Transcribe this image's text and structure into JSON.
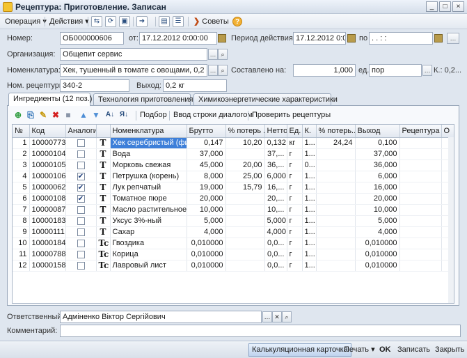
{
  "window": {
    "title": "Рецептура: Приготовление. Записан",
    "minimize": "_",
    "maximize": "□",
    "close": "×"
  },
  "toolbar": {
    "operation": "Операция ▾",
    "actions": "Действия ▾",
    "tips": "Советы"
  },
  "header": {
    "number_label": "Номер:",
    "number_value": "ОБ000000606",
    "from_label": "от:",
    "from_value": "17.12.2012  0:00:00",
    "period_label": "Период действия с:",
    "period_from": "17.12.2012  0:00:00",
    "period_to_label": "по",
    "period_to": " .  .    :  :",
    "org_label": "Организация:",
    "org_value": "Общепит сервис",
    "nom_label": "Номенклатура:",
    "nom_value": "Хек, тушенный в томате с овощами, 0,2 кг",
    "composed_label": "Составлено на:",
    "composed_value": "1,000",
    "unit_label": "ед.:",
    "unit_value": "пор",
    "k_label": "К.: 0,2...",
    "recipe_no_label": "Ном. рецептуры:",
    "recipe_no_value": "340-2",
    "yield_label": "Выход:",
    "yield_value": "0,2 кг"
  },
  "tabs": [
    "Ингредиенты (12 поз.)",
    "Технология приготовления",
    "Химикоэнергетические характеристики"
  ],
  "grid_toolbar": {
    "selection": "Подбор",
    "enter_row": "Ввод строки диалогом",
    "check": "Проверить рецептуры"
  },
  "columns": [
    "№",
    "Код",
    "Аналоги",
    "",
    "Номенклатура",
    "Брутто",
    "% потерь ...",
    "Нетто",
    "Ед.",
    "К.",
    "% потерь...",
    "Выход",
    "Рецептура",
    "О"
  ],
  "rows": [
    [
      "1",
      "10000773",
      "",
      "T",
      "Хек серебристый (фи...",
      "0,147",
      "10,20",
      "0,132",
      "кг",
      "1...",
      "24,24",
      "0,100",
      "",
      ""
    ],
    [
      "2",
      "10000104",
      "",
      "T",
      "Вода",
      "37,000",
      "",
      "37,...",
      "г",
      "1...",
      "",
      "37,000",
      "",
      ""
    ],
    [
      "3",
      "10000105",
      "",
      "T",
      "Морковь свежая",
      "45,000",
      "20,00",
      "36,...",
      "г",
      "0...",
      "",
      "36,000",
      "",
      ""
    ],
    [
      "4",
      "10000106",
      "✔",
      "T",
      "Петрушка (корень)",
      "8,000",
      "25,00",
      "6,000",
      "г",
      "1...",
      "",
      "6,000",
      "",
      ""
    ],
    [
      "5",
      "10000062",
      "✔",
      "T",
      "Лук репчатый",
      "19,000",
      "15,79",
      "16,...",
      "г",
      "1...",
      "",
      "16,000",
      "",
      ""
    ],
    [
      "6",
      "10000108",
      "✔",
      "T",
      "Томатное пюре",
      "20,000",
      "",
      "20,...",
      "г",
      "1...",
      "",
      "20,000",
      "",
      ""
    ],
    [
      "7",
      "10000087",
      "",
      "T",
      "Масло растительное",
      "10,000",
      "",
      "10,...",
      "г",
      "1...",
      "",
      "10,000",
      "",
      ""
    ],
    [
      "8",
      "10000183",
      "",
      "T",
      "Уксус 3%-ный",
      "5,000",
      "",
      "5,000",
      "г",
      "1...",
      "",
      "5,000",
      "",
      ""
    ],
    [
      "9",
      "10000111",
      "",
      "T",
      "Сахар",
      "4,000",
      "",
      "4,000",
      "г",
      "1...",
      "",
      "4,000",
      "",
      ""
    ],
    [
      "10",
      "10000184",
      "",
      "Tc",
      "Гвоздика",
      "0,010000",
      "",
      "0,0...",
      "г",
      "1...",
      "",
      "0,010000",
      "",
      ""
    ],
    [
      "11",
      "10000788",
      "",
      "Tc",
      "Корица",
      "0,010000",
      "",
      "0,0...",
      "г",
      "1...",
      "",
      "0,010000",
      "",
      ""
    ],
    [
      "12",
      "10000158",
      "",
      "Tc",
      "Лавровый лист",
      "0,010000",
      "",
      "0,0...",
      "г",
      "1...",
      "",
      "0,010000",
      "",
      ""
    ]
  ],
  "responsible_label": "Ответственный:",
  "responsible_value": "Адміненко Віктор Сергійович",
  "comment_label": "Комментарий:",
  "comment_value": "",
  "footer": {
    "calc_card": "Калькуляционная карточка",
    "print": "Печать ▾",
    "ok": "OK",
    "save": "Записать",
    "close": "Закрыть"
  }
}
